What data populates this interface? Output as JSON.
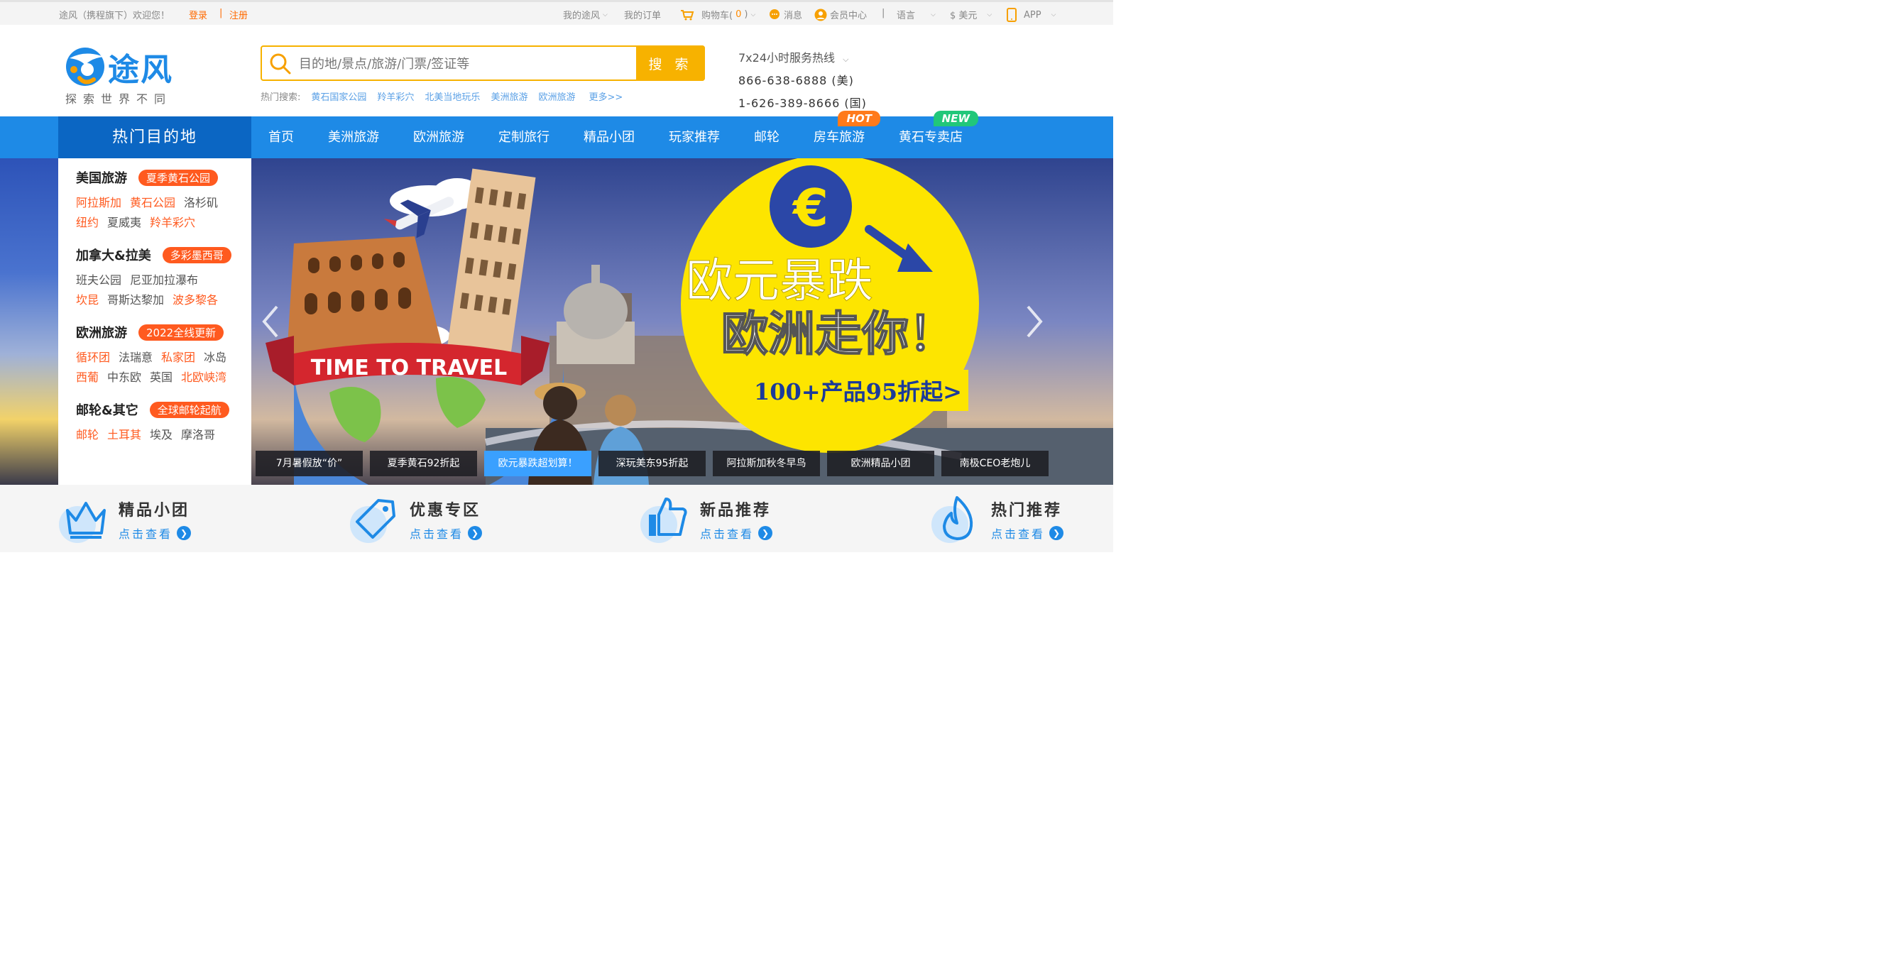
{
  "topbar": {
    "welcome": "途风（携程旗下）欢迎您！",
    "login": "登录",
    "separator": "|",
    "register": "注册",
    "my_tufeng": "我的途风",
    "my_orders": "我的订单",
    "cart_label": "购物车(",
    "cart_count": "0",
    "cart_close": ")",
    "messages": "消息",
    "member_center": "会员中心",
    "divider": "|",
    "language": "语言",
    "currency": "$ 美元",
    "app": "APP"
  },
  "header": {
    "brand_name": "途风",
    "slogan": "探索世界不同",
    "search_placeholder": "目的地/景点/旅游/门票/签证等",
    "search_button": "搜 索",
    "hot_search_label": "热门搜索:",
    "hot_search_items": [
      "黄石国家公园",
      "羚羊彩穴",
      "北美当地玩乐",
      "美洲旅游",
      "欧洲旅游"
    ],
    "hot_search_more": "更多>>",
    "hotline_title": "7x24小时服务热线",
    "phone_us": "866-638-6888 (美)",
    "phone_cn": "1-626-389-8666 (国)"
  },
  "nav": {
    "hot_destinations": "热门目的地",
    "items": [
      {
        "label": "首页"
      },
      {
        "label": "美洲旅游"
      },
      {
        "label": "欧洲旅游"
      },
      {
        "label": "定制旅行"
      },
      {
        "label": "精品小团"
      },
      {
        "label": "玩家推荐"
      },
      {
        "label": "邮轮"
      },
      {
        "label": "房车旅游",
        "badge": "HOT"
      },
      {
        "label": "黄石专卖店",
        "badge": "NEW"
      }
    ]
  },
  "categories": [
    {
      "title": "美国旅游",
      "tag": "夏季黄石公园",
      "rows": [
        [
          "阿拉斯加",
          "黄石公园",
          "洛杉矶"
        ],
        [
          "纽约",
          "夏威夷",
          "羚羊彩穴"
        ]
      ]
    },
    {
      "title": "加拿大&拉美",
      "tag": "多彩墨西哥",
      "rows": [
        [
          "班夫公园",
          "尼亚加拉瀑布"
        ],
        [
          "坎昆",
          "哥斯达黎加",
          "波多黎各"
        ]
      ]
    },
    {
      "title": "欧洲旅游",
      "tag": "2022全线更新",
      "rows": [
        [
          "循环团",
          "法瑞意",
          "私家团",
          "冰岛"
        ],
        [
          "西葡",
          "中东欧",
          "英国",
          "北欧峡湾"
        ]
      ]
    },
    {
      "title": "邮轮&其它",
      "tag": "全球邮轮起航",
      "rows": [
        [
          "邮轮",
          "土耳其",
          "埃及",
          "摩洛哥"
        ]
      ]
    }
  ],
  "banner": {
    "time_to_travel": "TIME TO TRAVEL",
    "euro_symbol": "€",
    "headline_1": "欧元暴跌",
    "headline_2": "欧洲走你！",
    "promo": "100+产品95折起>"
  },
  "slide_tabs": [
    "7月暑假放“价”",
    "夏季黄石92折起",
    "欧元暴跌超划算！",
    "深玩美东95折起",
    "阿拉斯加秋冬早鸟",
    "欧洲精品小团",
    "南极CEO老炮儿"
  ],
  "features": [
    {
      "title": "精品小团",
      "link": "点击查看",
      "icon": "crown-icon"
    },
    {
      "title": "优惠专区",
      "link": "点击查看",
      "icon": "tag-icon"
    },
    {
      "title": "新品推荐",
      "link": "点击查看",
      "icon": "thumbs-up-icon"
    },
    {
      "title": "热门推荐",
      "link": "点击查看",
      "icon": "flame-icon"
    }
  ],
  "colors": {
    "brand_blue": "#1e8ae6",
    "nav_dark": "#0b66c3",
    "accent_orange": "#ff5a1f",
    "search_yellow": "#f7b200",
    "banner_yellow": "#fde500"
  }
}
